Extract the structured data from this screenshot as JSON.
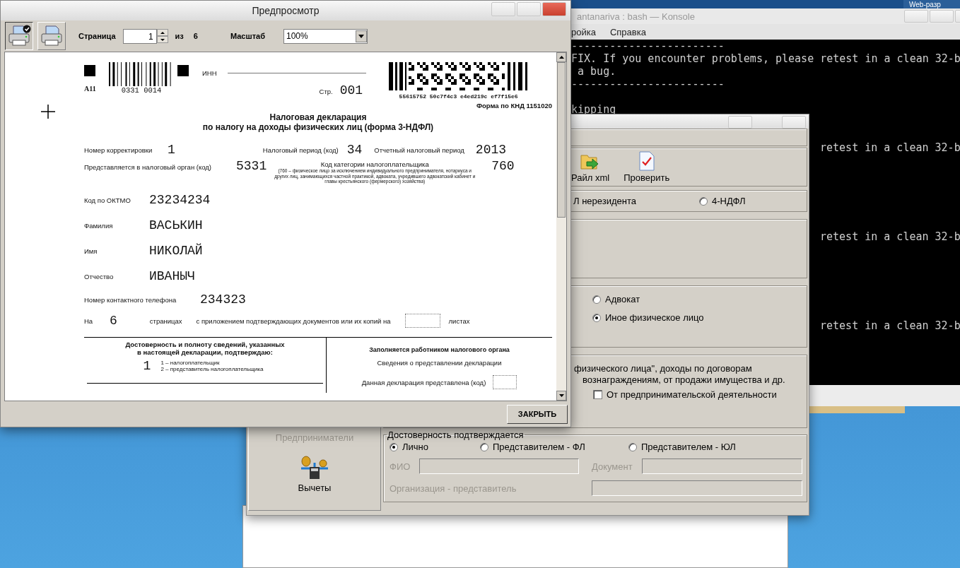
{
  "desktop": {
    "taskbar_item": "Web-разр"
  },
  "terminal": {
    "title": "antanariva : bash — Konsole",
    "menu": [
      "ройка",
      "Справка"
    ],
    "lines": [
      "------------------------",
      "FIX. If you encounter problems, please retest in a clean 32-b",
      " a bug.",
      "------------------------"
    ],
    "status_line": "kipping",
    "tail_lines": [
      "retest in a clean 32-b",
      "retest in a clean 32-b",
      "retest in a clean 32-b"
    ]
  },
  "tax_app": {
    "toolbar": [
      {
        "label": "Райл xml",
        "kind": "export"
      },
      {
        "label": "Проверить",
        "kind": "check"
      }
    ],
    "resident_label_tail": "Л нерезидента",
    "declaration_types": [
      {
        "label": "4-НДФЛ",
        "selected": false
      }
    ],
    "taxpayer_types": [
      {
        "label": "Адвокат",
        "selected": false
      },
      {
        "label": "Иное физическое лицо",
        "selected": true
      }
    ],
    "income_note": [
      "физического лица\", доходы по договорам",
      "вознаграждениям, от продажи имущества и др."
    ],
    "income_options": [
      {
        "label": "От предпринимательской деятельности",
        "checked": false
      }
    ],
    "sidebar": [
      {
        "label": "Предприниматели",
        "disabled": true,
        "kind": "plain"
      },
      {
        "label": "Вычеты",
        "disabled": false,
        "kind": "deductions"
      }
    ],
    "confirmation": {
      "legend": "Достоверность подтверждается",
      "options": [
        {
          "label": "Лично",
          "selected": true
        },
        {
          "label": "Представителем - ФЛ",
          "selected": false
        },
        {
          "label": "Представителем - ЮЛ",
          "selected": false
        }
      ],
      "fields": [
        {
          "label": "ФИО",
          "disabled": true
        },
        {
          "label": "Документ",
          "disabled": true
        },
        {
          "label": "Организация - представитель",
          "disabled": true
        }
      ]
    }
  },
  "preview": {
    "title": "Предпросмотр",
    "print_buttons": [
      {
        "kind": "setup",
        "pressed": true
      },
      {
        "kind": "print",
        "pressed": false
      }
    ],
    "page_label": "Страница",
    "page_value": "1",
    "of_label": "из",
    "page_count": "6",
    "zoom_label": "Масштаб",
    "zoom_value": "100%",
    "close_button": "ЗАКРЫТЬ",
    "document": {
      "barcode_code": "A11",
      "barcode_digits": "0331 0014",
      "inn_label": "ИНН",
      "page_label": "Стр.",
      "page_number": "001",
      "hash": "55615752 50c7f4c3 e4ed219c ef7f15e6",
      "form_code": "Форма по КНД 1151020",
      "title": [
        "Налоговая декларация",
        "по налогу на доходы физических лиц (форма 3-НДФЛ)"
      ],
      "correction_label": "Номер корректировки",
      "correction": "1",
      "period_label": "Налоговый период (код)",
      "period": "34",
      "year_label": "Отчетный налоговый период",
      "year": "2013",
      "authority_label": "Представляется в налоговый орган (код)",
      "authority": "5331",
      "category_label": "Код категории налогоплательщика",
      "category_note": "(760 – физическое лицо за исключением индивидуального предпринимателя, нотариуса и других лиц, занимающихся частной практикой, адвоката, учредившего адвокатский кабинет и главы крестьянского (фермерского) хозяйства)",
      "category": "760",
      "person_fields": [
        {
          "label": "Код по ОКТМО",
          "value": "23234234"
        },
        {
          "label": "Фамилия",
          "value": "ВАСЬКИН"
        },
        {
          "label": "Имя",
          "value": "НИКОЛАЙ"
        },
        {
          "label": "Отчество",
          "value": "ИВАНЫЧ"
        },
        {
          "label": "Номер контактного телефона",
          "value": "234323"
        }
      ],
      "pages_label": "На",
      "pages": "6",
      "pages_unit": "страницах",
      "attachments_label": "с приложением подтверждающих документов или их копий на",
      "attachments_unit": "листах",
      "confirm_title": [
        "Достоверность и полноту сведений, указанных",
        "в настоящей декларации, подтверждаю:"
      ],
      "confirm_code": "1",
      "confirm_options": [
        "1 – налогоплательщик",
        "2 – представитель налогоплательщика"
      ],
      "office_title": "Заполняется работником налогового органа",
      "office_subtitle": "Сведения о представлении декларации",
      "office_field": "Данная декларация представлена (код)"
    }
  }
}
